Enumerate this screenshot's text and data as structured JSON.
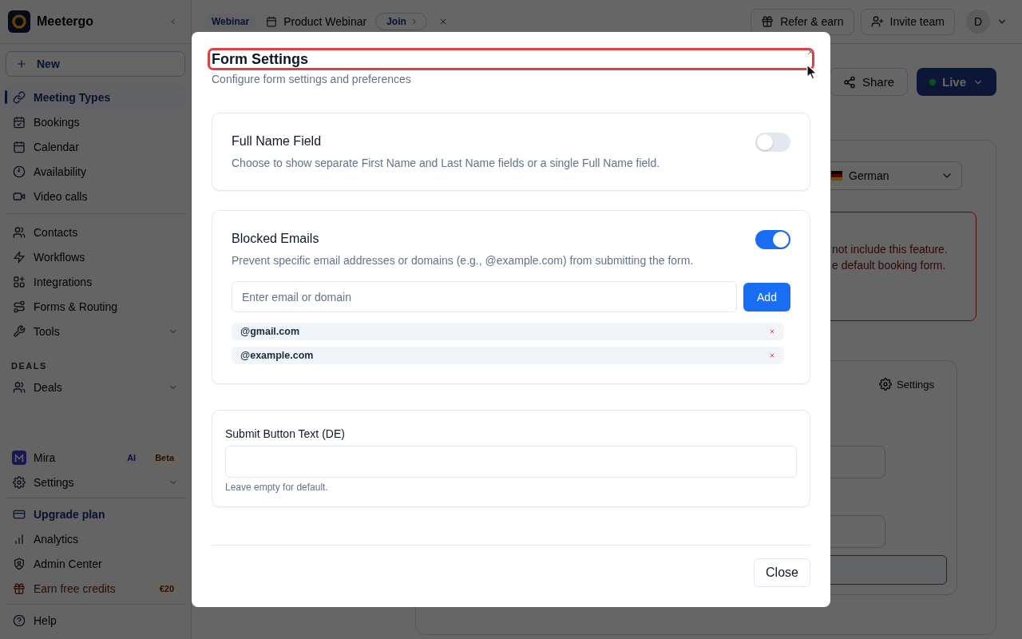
{
  "sidebar": {
    "brand": "Meetergo",
    "new_button": "New",
    "groups": [
      {
        "items": [
          {
            "label": "Meeting Types",
            "kind": "link",
            "selected": true
          },
          {
            "label": "Bookings",
            "kind": "link",
            "selected": false
          },
          {
            "label": "Calendar",
            "kind": "link",
            "selected": false
          },
          {
            "label": "Availability",
            "kind": "link",
            "selected": false
          },
          {
            "label": "Video calls",
            "kind": "link",
            "selected": false
          }
        ]
      },
      {
        "items": [
          {
            "label": "Contacts",
            "kind": "link",
            "selected": false
          },
          {
            "label": "Workflows",
            "kind": "link",
            "selected": false
          },
          {
            "label": "Integrations",
            "kind": "link",
            "selected": false
          },
          {
            "label": "Forms & Routing",
            "kind": "link",
            "selected": false
          },
          {
            "label": "Tools",
            "kind": "menu",
            "selected": false
          }
        ]
      },
      {
        "heading": "DEALS",
        "items": [
          {
            "label": "Deals",
            "kind": "menu",
            "selected": false
          }
        ]
      }
    ],
    "footer_groups": [
      {
        "items": [
          {
            "label": "Mira",
            "kind": "link",
            "selected": false,
            "badges": [
              {
                "label": "AI",
                "kind": "ai"
              },
              {
                "label": "Beta",
                "kind": "beta"
              }
            ]
          },
          {
            "label": "Settings",
            "kind": "menu",
            "selected": false
          }
        ]
      },
      {
        "items": [
          {
            "label": "Upgrade plan",
            "kind": "upgrade",
            "selected": false
          },
          {
            "label": "Analytics",
            "kind": "link",
            "selected": false
          },
          {
            "label": "Admin Center",
            "kind": "link",
            "selected": false
          },
          {
            "label": "Earn free credits",
            "kind": "reward",
            "selected": false,
            "badges": [
              {
                "label": "€20",
                "kind": "reward"
              }
            ]
          }
        ]
      },
      {
        "items": [
          {
            "label": "Help",
            "kind": "link",
            "selected": false
          }
        ]
      }
    ]
  },
  "topbar": {
    "event_type": "Webinar",
    "event_title": "Product Webinar",
    "join_button": "Join",
    "actions": [
      "Refer & earn",
      "Invite team"
    ],
    "avatar": "D"
  },
  "page_header": {
    "share_button": "Share",
    "live_button": "Live"
  },
  "content": {
    "language": "German",
    "alert_lines": [
      "not include this feature.",
      "e default booking form."
    ],
    "settings_button": "Settings"
  },
  "modal": {
    "title": "Form Settings",
    "highlighted": true,
    "subtitle": "Configure form settings and preferences",
    "sections": [
      {
        "kind": "toggle",
        "title": "Full Name Field",
        "description": "Choose to show separate First Name and Last Name fields or a single Full Name field.",
        "on": false
      },
      {
        "kind": "list",
        "title": "Blocked Emails",
        "description": "Prevent specific email addresses or domains (e.g., @example.com) from submitting the form.",
        "on": true,
        "input": {
          "placeholder": "Enter email or domain"
        },
        "add_button": "Add",
        "entries": [
          "@gmail.com",
          "@example.com"
        ]
      },
      {
        "kind": "text_field",
        "label": "Submit Button Text (DE)",
        "help": "Leave empty for default."
      }
    ],
    "close_button": "Close"
  }
}
